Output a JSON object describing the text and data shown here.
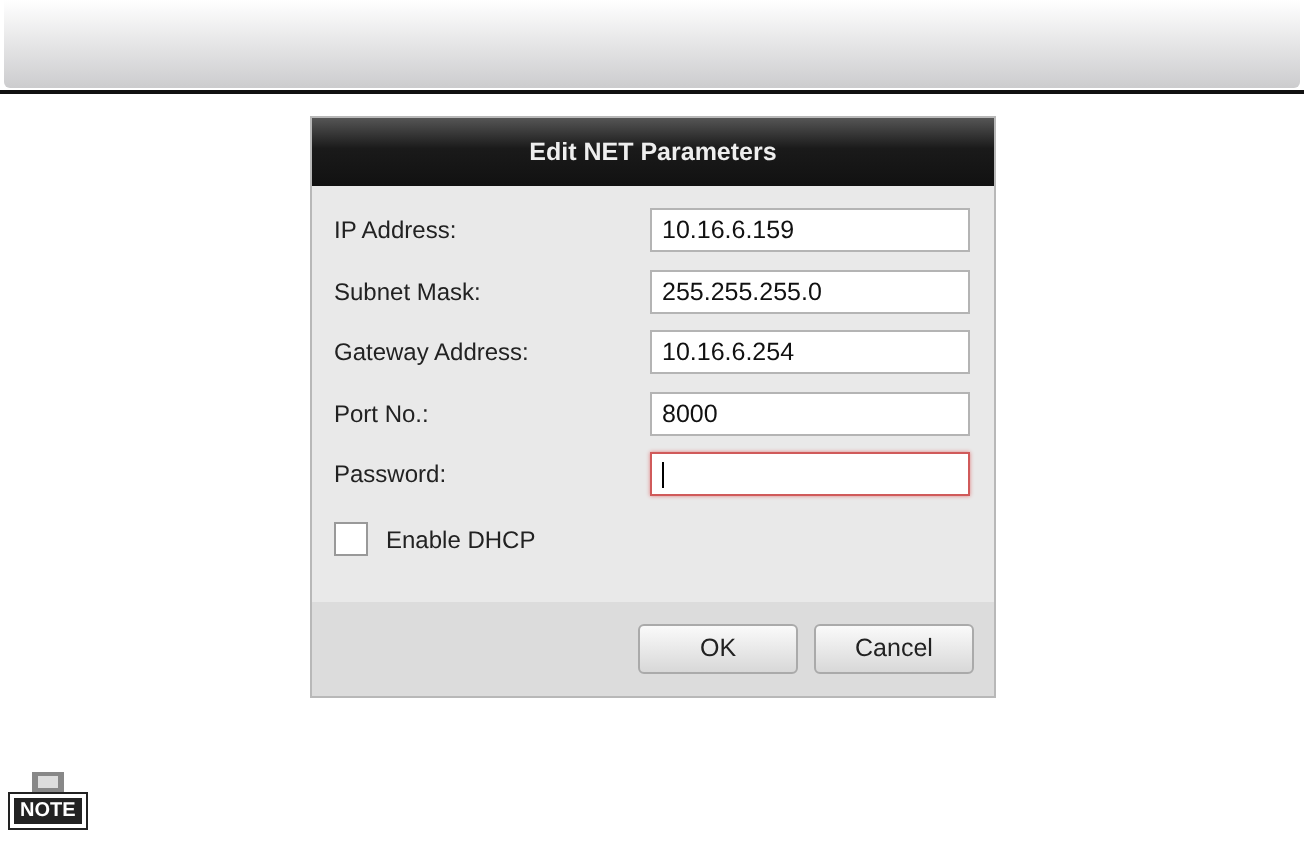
{
  "dialog": {
    "title": "Edit NET Parameters",
    "fields": [
      {
        "label": "IP Address:",
        "value": "10.16.6.159",
        "focused": false
      },
      {
        "label": "Subnet Mask:",
        "value": "255.255.255.0",
        "focused": false
      },
      {
        "label": "Gateway Address:",
        "value": "10.16.6.254",
        "focused": false
      },
      {
        "label": "Port No.:",
        "value": "8000",
        "focused": false
      },
      {
        "label": "Password:",
        "focused": true
      }
    ],
    "checkbox": {
      "label": "Enable DHCP",
      "checked": false
    },
    "buttons": [
      "OK",
      "Cancel"
    ]
  },
  "note": {
    "label": "NOTE"
  }
}
